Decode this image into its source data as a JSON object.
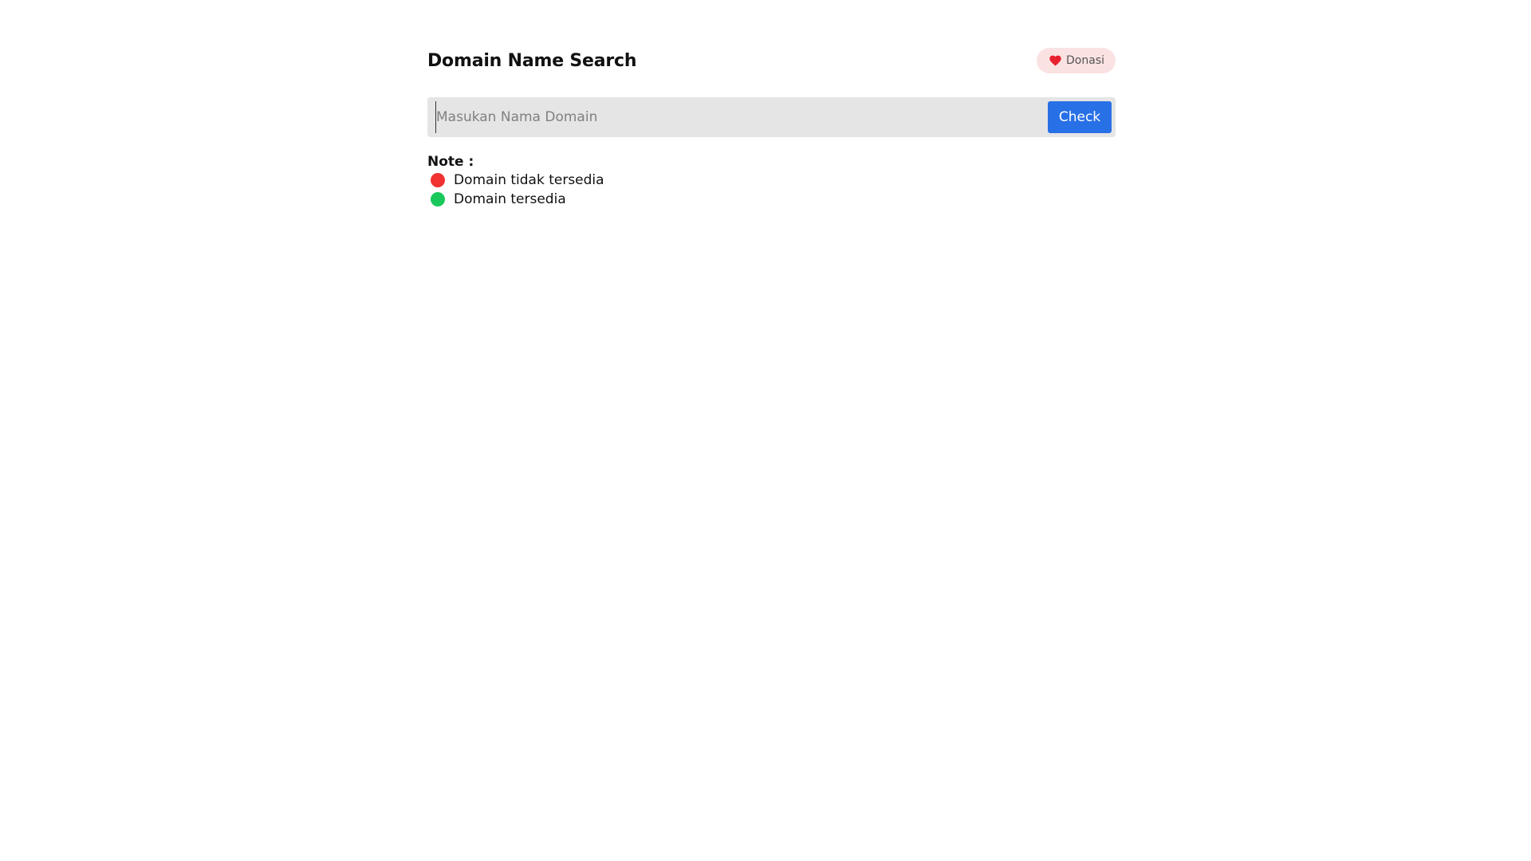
{
  "header": {
    "title": "Domain Name Search",
    "donate_label": "Donasi",
    "donate_icon": "heart-icon"
  },
  "search": {
    "placeholder": "Masukan Nama Domain",
    "value": "",
    "button_label": "Check"
  },
  "note": {
    "title": "Note :",
    "items": [
      {
        "label": "Domain tidak tersedia",
        "color": "#f03232"
      },
      {
        "label": "Domain tersedia",
        "color": "#19c85a"
      }
    ]
  },
  "colors": {
    "accent": "#2870e6",
    "donate_bg": "#fbe2e2",
    "heart": "#e8202f"
  }
}
